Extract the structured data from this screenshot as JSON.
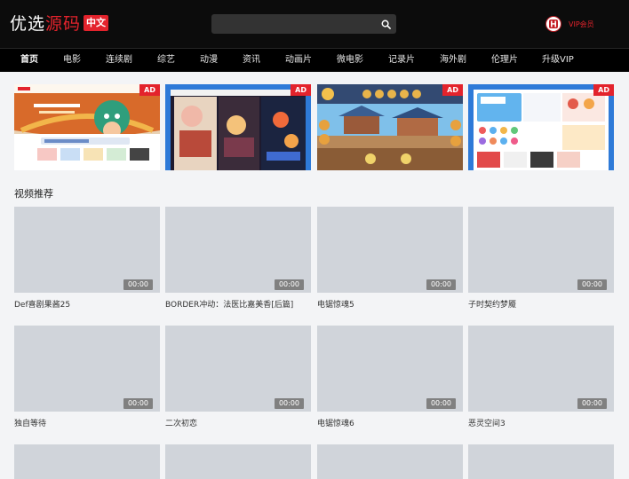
{
  "header": {
    "logo_part1": "优选",
    "logo_part2": "源码",
    "logo_badge": "中文",
    "search": {
      "placeholder": "",
      "value": ""
    },
    "vip_label": "VIP会员"
  },
  "nav": {
    "items": [
      "首页",
      "电影",
      "连续剧",
      "综艺",
      "动漫",
      "资讯",
      "动画片",
      "微电影",
      "记录片",
      "海外剧",
      "伦理片",
      "升级VIP"
    ],
    "active": "首页"
  },
  "ads": [
    {
      "tag": "AD"
    },
    {
      "tag": "AD"
    },
    {
      "tag": "AD"
    },
    {
      "tag": "AD"
    }
  ],
  "section": {
    "title": "视频推荐"
  },
  "videos": [
    {
      "title": "Def喜剧果酱25",
      "duration": "00:00"
    },
    {
      "title": "BORDER冲动：法医比嘉美香[后篇]",
      "duration": "00:00"
    },
    {
      "title": "电锯惊魂5",
      "duration": "00:00"
    },
    {
      "title": "子时契约梦魇",
      "duration": "00:00"
    },
    {
      "title": "独自等待",
      "duration": "00:00"
    },
    {
      "title": "二次初恋",
      "duration": "00:00"
    },
    {
      "title": "电锯惊魂6",
      "duration": "00:00"
    },
    {
      "title": "恶灵空间3",
      "duration": "00:00"
    }
  ],
  "colors": {
    "accent": "#e3232c",
    "header_bg": "#0c0c0c",
    "thumb_placeholder": "#d0d4da",
    "page_bg": "#f3f4f6"
  }
}
